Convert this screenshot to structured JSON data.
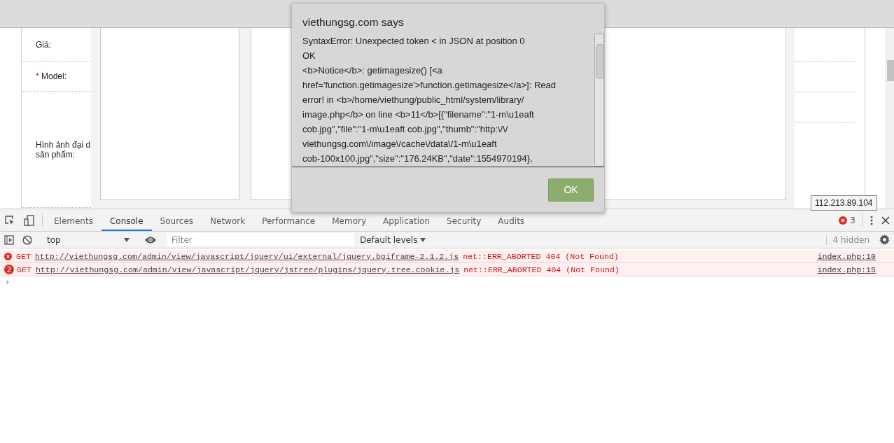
{
  "page": {
    "form_labels": [
      {
        "text": "Giá:",
        "required": false
      },
      {
        "text": "Model:",
        "required": true,
        "marker": "*"
      },
      {
        "text": "Hình ảnh đại d\nsản phẩm:",
        "required": false
      }
    ],
    "tooltip": "112.213.89.104"
  },
  "dialog": {
    "title": "viethungsg.com says",
    "message_lines": [
      "SyntaxError: Unexpected token < in JSON at position 0",
      "OK",
      "<b>Notice</b>: getimagesize() [<a",
      "href='function.getimagesize'>function.getimagesize</a>]: Read",
      "error! in <b>/home/viethung/public_html/system/library/",
      "image.php</b> on line <b>11</b>[{\"filename\":\"1-m\\u1eaft",
      "cob.jpg\",\"file\":\"1-m\\u1eaft cob.jpg\",\"thumb\":\"http:\\/\\/",
      "viethungsg.com\\/image\\/cache\\/data\\/1-m\\u1eaft",
      "cob-100x100.jpg\",\"size\":\"176.24KB\",\"date\":1554970194},"
    ],
    "button": "OK"
  },
  "devtools": {
    "tabs": [
      {
        "label": "Elements",
        "selected": false
      },
      {
        "label": "Console",
        "selected": true
      },
      {
        "label": "Sources",
        "selected": false
      },
      {
        "label": "Network",
        "selected": false
      },
      {
        "label": "Performance",
        "selected": false
      },
      {
        "label": "Memory",
        "selected": false
      },
      {
        "label": "Application",
        "selected": false
      },
      {
        "label": "Security",
        "selected": false
      },
      {
        "label": "Audits",
        "selected": false
      }
    ],
    "error_count": "3",
    "toolbar": {
      "context": "top",
      "filter_placeholder": "Filter",
      "levels": "Default levels",
      "hidden": "4 hidden"
    },
    "messages": [
      {
        "method": "GET",
        "url": "http://viethungsg.com/admin/view/javascript/jquery/ui/external/jquery.bgiframe-2.1.2.js",
        "error": "net::ERR_ABORTED 404 (Not Found)",
        "source": "index.php:10"
      },
      {
        "count": "2",
        "method": "GET",
        "url": "http://viethungsg.com/admin/view/javascript/jquery/jstree/plugins/jquery.tree.cookie.js",
        "error": "net::ERR_ABORTED 404 (Not Found)",
        "source": "index.php:15"
      }
    ],
    "prompt": "›"
  }
}
